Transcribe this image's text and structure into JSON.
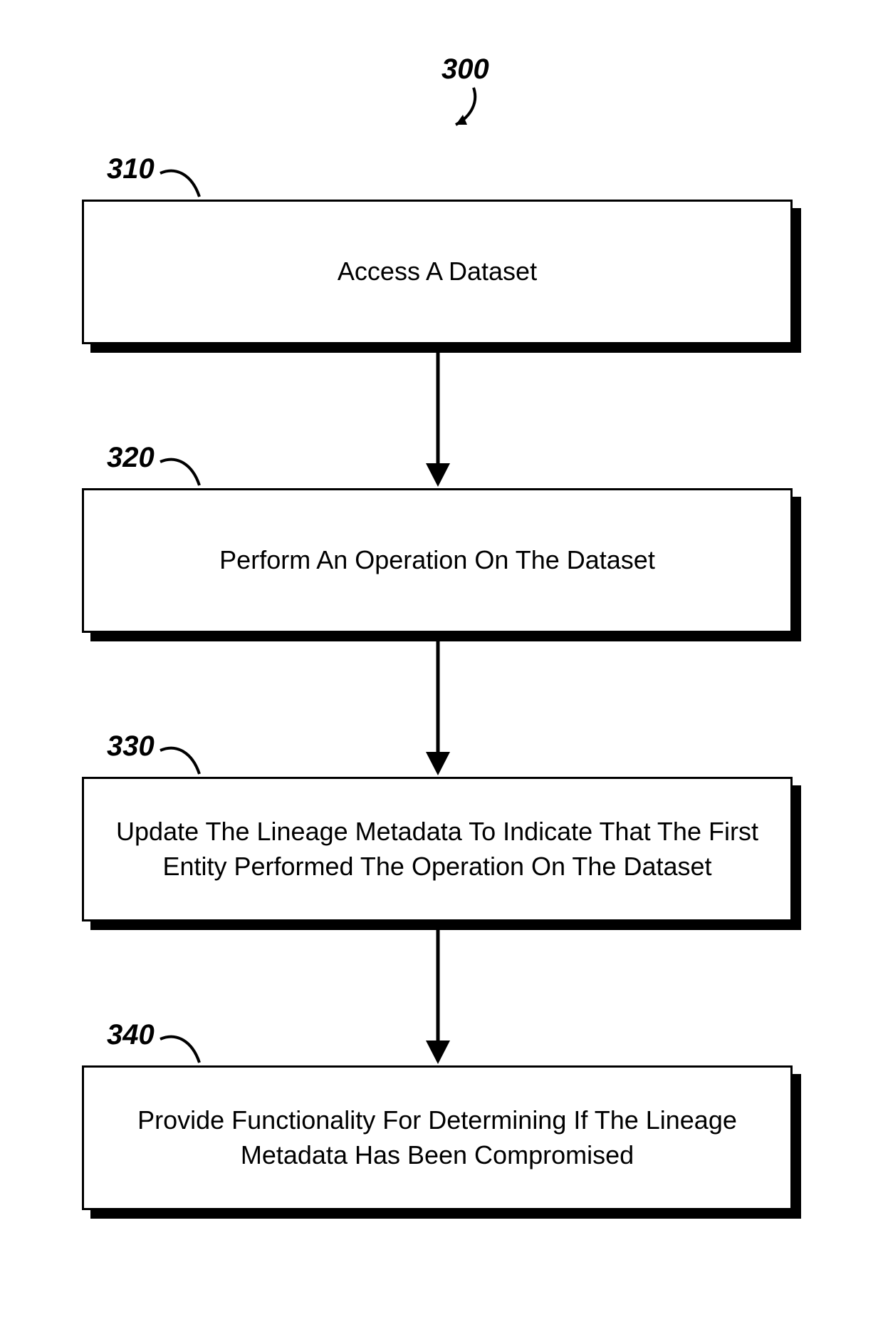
{
  "title": {
    "label": "300"
  },
  "steps": [
    {
      "id": "310",
      "label": "310",
      "text": "Access A Dataset"
    },
    {
      "id": "320",
      "label": "320",
      "text": "Perform An Operation On The Dataset"
    },
    {
      "id": "330",
      "label": "330",
      "text": "Update The Lineage Metadata To Indicate That The First Entity Performed The Operation On The Dataset"
    },
    {
      "id": "340",
      "label": "340",
      "text": "Provide Functionality For Determining If The Lineage Metadata Has Been Compromised"
    }
  ]
}
